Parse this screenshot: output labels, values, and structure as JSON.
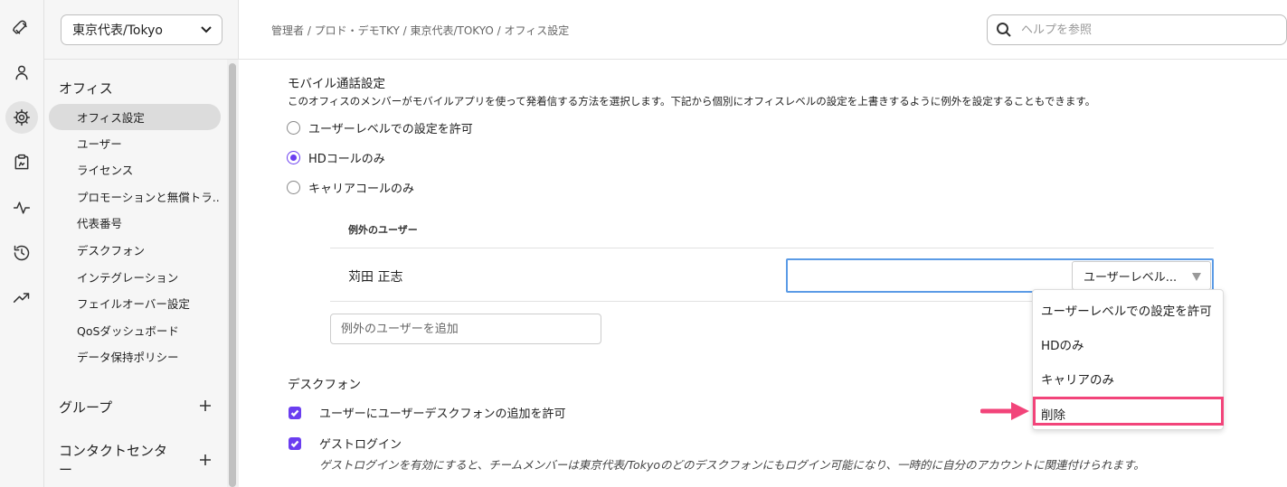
{
  "sidebar": {
    "office_select_value": "東京代表/Tokyo",
    "section_office": "オフィス",
    "items": [
      {
        "label": "オフィス設定"
      },
      {
        "label": "ユーザー"
      },
      {
        "label": "ライセンス"
      },
      {
        "label": "プロモーションと無償トラ..."
      },
      {
        "label": "代表番号"
      },
      {
        "label": "デスクフォン"
      },
      {
        "label": "インテグレーション"
      },
      {
        "label": "フェイルオーバー設定"
      },
      {
        "label": "QoSダッシュボード"
      },
      {
        "label": "データ保持ポリシー"
      }
    ],
    "section_group": "グループ",
    "section_contact_line1": "コンタクトセンタ",
    "section_contact_line2": "ー"
  },
  "rail_icons": [
    "rocket-icon",
    "user-icon",
    "gear-icon",
    "clipboard-icon",
    "activity-icon",
    "history-icon",
    "trending-icon"
  ],
  "header": {
    "breadcrumb": "管理者 / プロド・デモTKY / 東京代表/TOKYO / オフィス設定",
    "search_placeholder": "ヘルプを参照"
  },
  "mobile": {
    "title": "モバイル通話設定",
    "description": "このオフィスのメンバーがモバイルアプリを使って発着信する方法を選択します。下記から個別にオフィスレベルの設定を上書きするように例外を設定することもできます。",
    "options": [
      {
        "label": "ユーザーレベルでの設定を許可",
        "checked": false
      },
      {
        "label": "HDコールのみ",
        "checked": true
      },
      {
        "label": "キャリアコールのみ",
        "checked": false
      }
    ]
  },
  "exceptions": {
    "header": "例外のユーザー",
    "user_name": "苅田 正志",
    "select_value": "ユーザーレベル...",
    "add_placeholder": "例外のユーザーを追加",
    "dropdown_options": [
      "ユーザーレベルでの設定を許可",
      "HDのみ",
      "キャリアのみ",
      "削除"
    ],
    "highlight_color": "#f2447a"
  },
  "deskphone": {
    "title": "デスクフォン",
    "allow_label": "ユーザーにユーザーデスクフォンの追加を許可",
    "guest_label": "ゲストログイン",
    "guest_desc": "ゲストログインを有効にすると、チームメンバーは東京代表/Tokyoのどのデスクフォンにもログイン可能になり、一時的に自分のアカウントに関連付けられます。"
  },
  "colors": {
    "accent": "#6b3ef0",
    "focus": "#5b9be6"
  }
}
